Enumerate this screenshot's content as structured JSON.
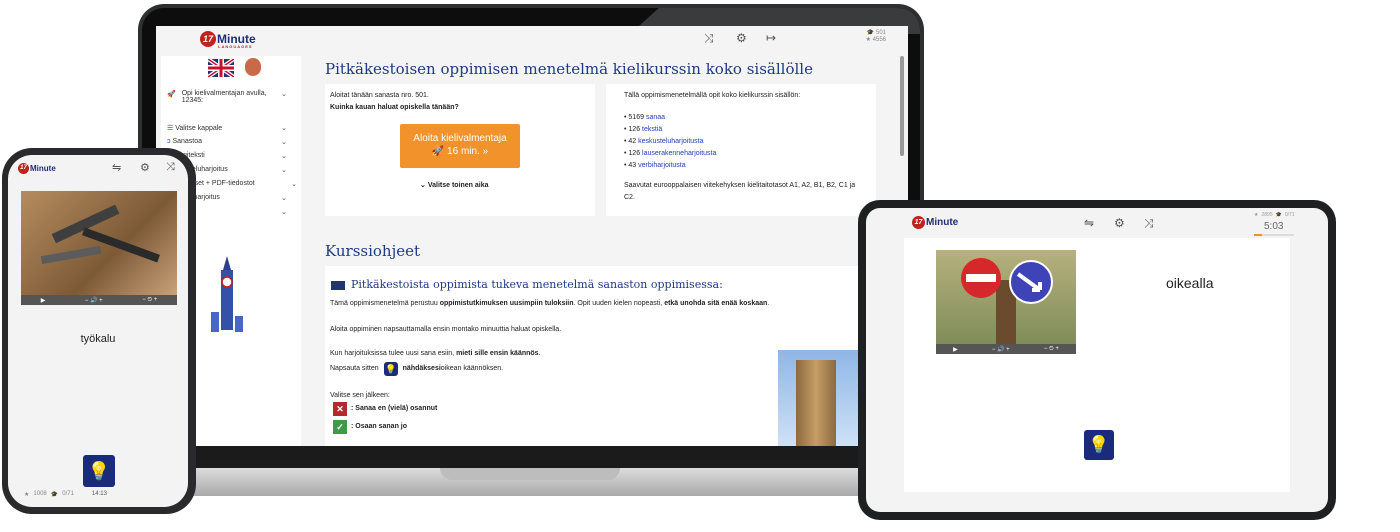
{
  "brand": {
    "logo_number": "17",
    "logo_word": "Minute",
    "logo_sub": "LANGUAGES"
  },
  "laptop": {
    "stats": {
      "cap": "501",
      "star": "4556"
    },
    "sidebar": {
      "learn_with": "Opi kielivalmentajan avulla, 12345:",
      "items": [
        "Valitse kappale",
        "Sanastoa",
        "Dialogiteksti",
        "Keskusteluharjoitus",
        "Harjoitukset + PDF-tiedostot",
        "Kielioppiharjoitus",
        ""
      ]
    },
    "title": "Pitkäkestoisen oppimisen menetelmä kielikurssin koko sisällölle",
    "left_card": {
      "line1": "Aloitat tänään sanasta nro. 501.",
      "line2": "Kuinka kauan haluat opiskella tänään?",
      "start_label": "Aloita kielivalmentaja",
      "start_time": "16 min.",
      "other_time": "Valitse toinen aika"
    },
    "right_card": {
      "intro": "Tällä oppimismenetelmällä opit koko kielikurssin sisällön:",
      "items": [
        {
          "num": "5169",
          "label": "sanaa"
        },
        {
          "num": "126",
          "label": "tekstiä"
        },
        {
          "num": "42",
          "label": "keskusteluharjoitusta"
        },
        {
          "num": "126",
          "label": "lauserakenneharjoitusta"
        },
        {
          "num": "43",
          "label": "verbiharjoitusta"
        }
      ],
      "outro": "Saavutat eurooppalaisen viitekehyksen kielitaitotasot A1, A2, B1, B2, C1 ja C2."
    },
    "instructions_title": "Kurssiohjeet",
    "instr": {
      "heading": "Pitkäkestoista oppimista tukeva menetelmä sanaston oppimisessa:",
      "p1_a": "Tämä oppimismenetelmä perustuu ",
      "p1_b": "oppimistutkimuksen uusimpiin tuloksiin",
      "p1_c": ". Opit uuden kielen nopeasti, ",
      "p1_d": "etkä unohda sitä enää koskaan",
      "p1_e": ".",
      "p2": "Aloita oppiminen napsauttamalla ensin montako minuuttia haluat opiskella.",
      "p3_a": "Kun harjoituksissa tulee uusi sana esiin, ",
      "p3_b": "mieti sille ensin käännös",
      "p3_c": ".",
      "p4_a": "Napsauta sitten ",
      "p4_b": "nähdäksesi",
      "p4_c": " oikean käännöksen.",
      "p5": "Valitse sen jälkeen:",
      "opt_no": ": Sanaa en (vielä) osannut",
      "opt_yes": ": Osaan sanan jo"
    }
  },
  "phone": {
    "word": "työkalu",
    "footer": {
      "star": "1008",
      "cap": "0/71",
      "time": "14:13"
    }
  },
  "tablet": {
    "word": "oikealla",
    "stats": {
      "star": "2895",
      "cap": "0/71"
    },
    "time": "5:03"
  },
  "colors": {
    "accent_orange": "#f2922a",
    "brand_blue": "#1e3a86",
    "bulb_blue": "#1c2a7c",
    "wrong_red": "#b5282c",
    "right_green": "#3d9a48"
  }
}
